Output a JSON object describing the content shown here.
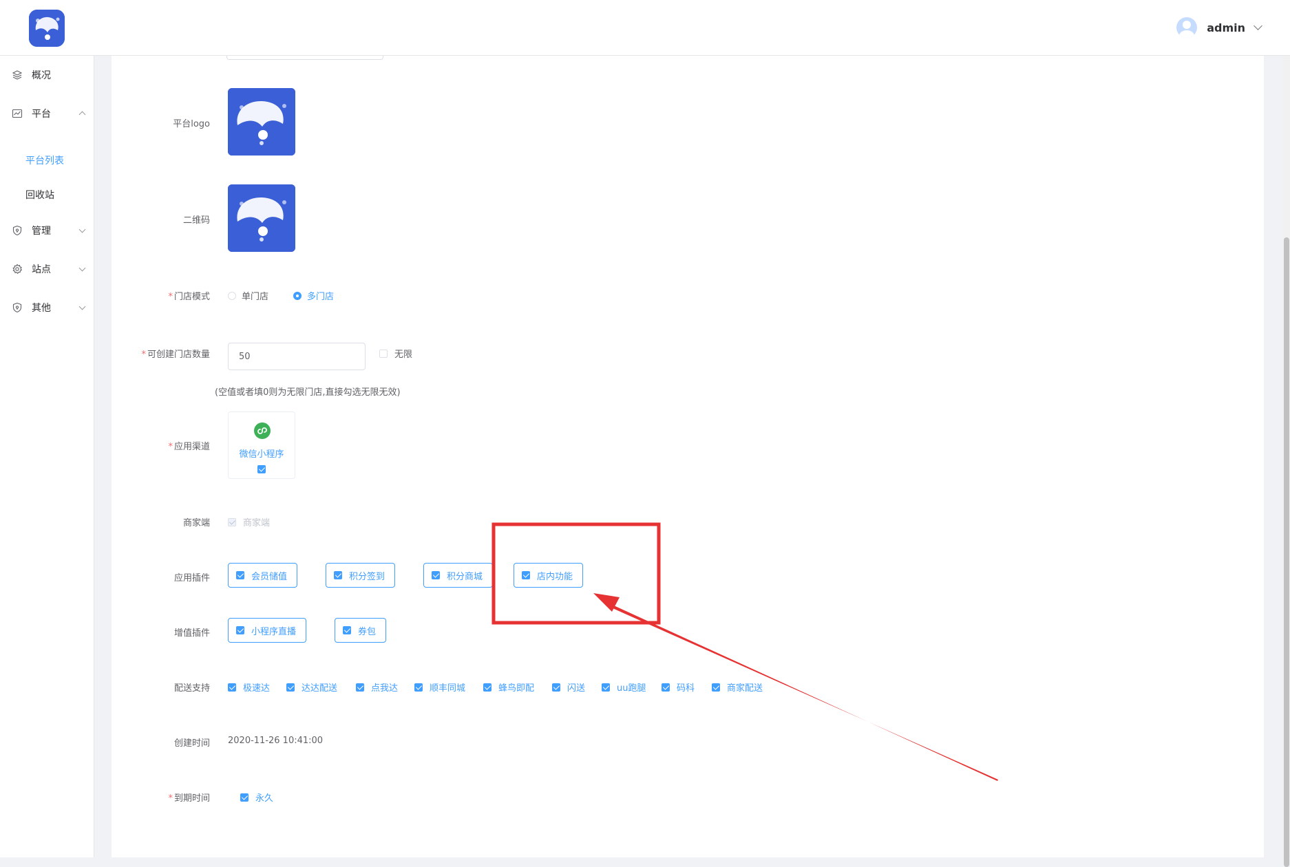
{
  "header": {
    "user_name": "admin",
    "colors": {
      "brand": "#3a5fd6",
      "accent": "#409eff",
      "annotation": "#e63232"
    }
  },
  "sidebar": {
    "items": [
      {
        "label": "概况",
        "icon": "layers-icon"
      },
      {
        "label": "平台",
        "icon": "line-chart-icon",
        "expanded": true
      },
      {
        "label": "管理",
        "icon": "shield-icon"
      },
      {
        "label": "站点",
        "icon": "gear-icon"
      },
      {
        "label": "其他",
        "icon": "shield-icon"
      }
    ],
    "sub_items": [
      {
        "label": "平台列表",
        "active": true
      },
      {
        "label": "回收站",
        "active": false
      }
    ]
  },
  "form": {
    "platform_logo_label": "平台logo",
    "qrcode_label": "二维码",
    "store_mode": {
      "required_mark": "*",
      "label": "门店模式",
      "options": [
        "单门店",
        "多门店"
      ],
      "selected": "多门店"
    },
    "store_count": {
      "required_mark": "*",
      "label": "可创建门店数量",
      "value": "50",
      "unlimited_label": "无限",
      "hint": "(空值或者填0则为无限门店,直接勾选无限无效)"
    },
    "app_channel": {
      "required_mark": "*",
      "label": "应用渠道",
      "channel_name": "微信小程序"
    },
    "merchant": {
      "label": "商家端",
      "option": "商家端"
    },
    "app_plugins": {
      "label": "应用插件",
      "items": [
        "会员储值",
        "积分签到",
        "积分商城",
        "店内功能"
      ]
    },
    "value_added_plugins": {
      "label": "增值插件",
      "items": [
        "小程序直播",
        "券包"
      ]
    },
    "delivery": {
      "label": "配送支持",
      "items": [
        "极速达",
        "达达配送",
        "点我达",
        "顺丰同城",
        "蜂鸟即配",
        "闪送",
        "uu跑腿",
        "码科",
        "商家配送"
      ]
    },
    "created_time": {
      "label": "创建时间",
      "value": "2020-11-26 10:41:00"
    },
    "expire_time": {
      "required_mark": "*",
      "label": "到期时间",
      "option": "永久"
    }
  }
}
